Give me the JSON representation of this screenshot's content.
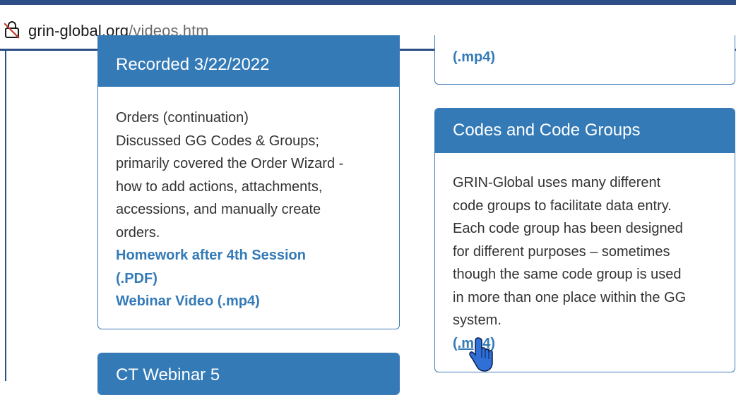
{
  "browser": {
    "url_host": "grin-global.org",
    "url_path": "/videos.htm",
    "lock_icon": "lock-icon"
  },
  "panels": {
    "session": {
      "heading": "Recorded 3/22/2022",
      "lines": [
        "Orders (continuation)",
        "Discussed GG Codes & Groups;",
        "primarily covered the Order Wizard -",
        "how to add actions, attachments,",
        "accessions, and manually create",
        "orders."
      ],
      "homework_link_line1": "Homework after 4th Session",
      "homework_link_line2": "(.PDF)",
      "video_link": "Webinar Video (.mp4)"
    },
    "top_right": {
      "link": "(.mp4)"
    },
    "codes": {
      "heading": "Codes and Code Groups",
      "lines": [
        "GRIN-Global uses many different",
        "code groups to facilitate data entry.",
        "Each code group has been designed",
        "for different purposes – sometimes",
        "though the same code group is used",
        "in more than one place within the GG",
        "system."
      ],
      "link": "(.mp4)"
    },
    "next": {
      "heading": "CT Webinar 5"
    }
  },
  "colors": {
    "panel_header": "#337ab7",
    "link": "#337ab7",
    "frame": "#2d4f86"
  },
  "cursor_icon": "hand-pointer-icon"
}
